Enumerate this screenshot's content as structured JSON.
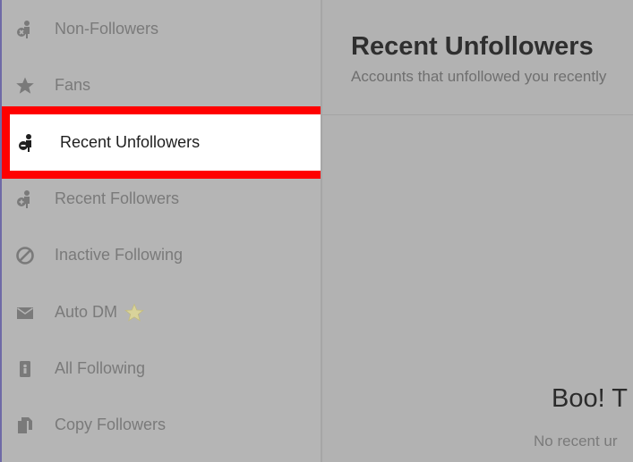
{
  "sidebar": {
    "items": [
      {
        "label": "Non-Followers",
        "icon": "person-cross-icon"
      },
      {
        "label": "Fans",
        "icon": "star-icon"
      },
      {
        "label": "Recent Unfollowers",
        "icon": "person-cross-icon",
        "active": true
      },
      {
        "label": "Recent Followers",
        "icon": "person-plus-icon"
      },
      {
        "label": "Inactive Following",
        "icon": "prohibited-icon"
      },
      {
        "label": "Auto DM",
        "icon": "envelope-icon",
        "badge": "premium-star-icon"
      },
      {
        "label": "All Following",
        "icon": "person-card-icon"
      },
      {
        "label": "Copy Followers",
        "icon": "copy-icon"
      }
    ]
  },
  "main": {
    "title": "Recent Unfollowers",
    "subtitle": "Accounts that unfollowed you recently",
    "empty_title": "Boo! T",
    "empty_subtitle": "No recent ur"
  },
  "colors": {
    "highlight": "#ff0000",
    "overlay_gray": "#b2b2b2",
    "active_bg": "#ffffff",
    "premium_star": "#d9d39a"
  }
}
